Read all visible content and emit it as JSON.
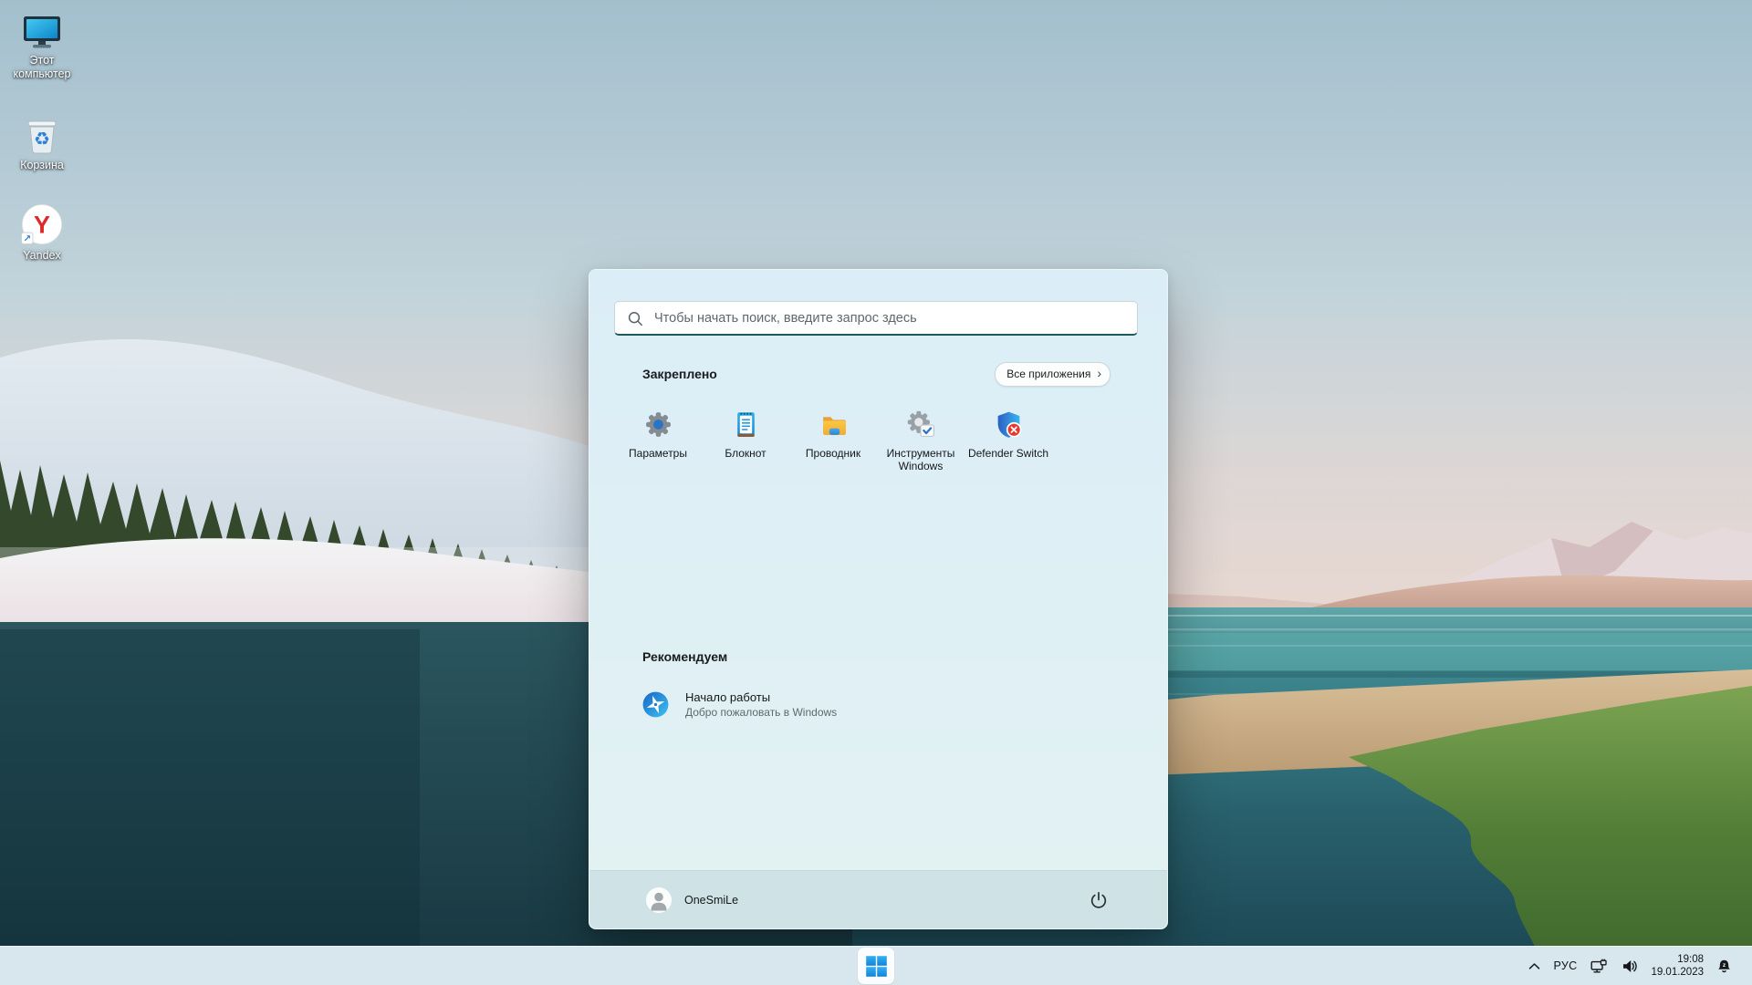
{
  "desktop": {
    "icons": [
      {
        "label": "Этот компьютер",
        "icon": "this-pc-icon"
      },
      {
        "label": "Корзина",
        "icon": "recycle-bin-icon"
      },
      {
        "label": "Yandex",
        "icon": "yandex-browser-icon"
      }
    ]
  },
  "start_menu": {
    "search_placeholder": "Чтобы начать поиск, введите запрос здесь",
    "pinned_title": "Закреплено",
    "all_apps_label": "Все приложения",
    "apps": [
      {
        "label": "Параметры",
        "icon": "settings-gear-icon"
      },
      {
        "label": "Блокнот",
        "icon": "notepad-icon"
      },
      {
        "label": "Проводник",
        "icon": "file-explorer-icon"
      },
      {
        "label": "Инструменты Windows",
        "icon": "windows-tools-icon"
      },
      {
        "label": "Defender Switch",
        "icon": "defender-shield-icon"
      }
    ],
    "recommended_title": "Рекомендуем",
    "recommended": [
      {
        "title": "Начало работы",
        "subtitle": "Добро пожаловать в Windows",
        "icon": "get-started-icon"
      }
    ],
    "user_name": "OneSmiLe"
  },
  "taskbar": {
    "language": "РУС",
    "time": "19:08",
    "date": "19.01.2023"
  },
  "icons": {
    "chevron_right": "›",
    "shortcut_arrow": "↗",
    "recycle_symbol": "♻",
    "yandex_letter": "Y"
  },
  "colors": {
    "accent_teal": "#1d5a5e",
    "windows_blue": "#1ba1e2",
    "defender_red": "#e23c2e",
    "yandex_red": "#e0272b",
    "menu_bg": "#dff0f4",
    "taskbar_bg": "#d8e7ee"
  }
}
